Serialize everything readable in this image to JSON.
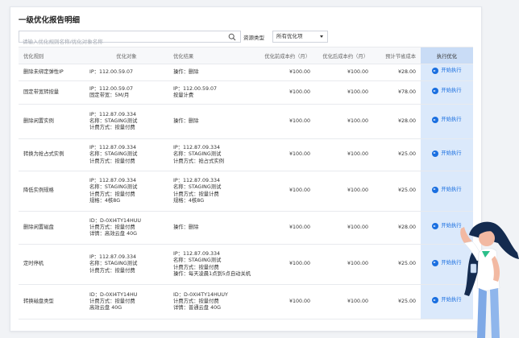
{
  "page_title": "一级优化报告明细",
  "search": {
    "placeholder": "请输入优化规则名称/优化对象名称"
  },
  "filter": {
    "label": "资源类型",
    "selected": "所有优化项"
  },
  "table": {
    "headers": [
      "优化规则",
      "优化对象",
      "优化结果",
      "优化前成本约（月）",
      "优化后成本约（月）",
      "预计节省成本",
      "执行优化"
    ],
    "rows": [
      {
        "rule": "删除未绑定弹性IP",
        "object": [
          "IP：112.00.59.07"
        ],
        "result": [
          "操作：删除"
        ],
        "before": "¥100.00",
        "after": "¥100.00",
        "saving": "¥28.00",
        "action": "开始执行"
      },
      {
        "rule": "固定带宽转按量",
        "object": [
          "IP：112.00.59.07",
          "固定带宽：5M/月"
        ],
        "result": [
          "IP：112.00.59.07",
          "按量计费"
        ],
        "before": "¥100.00",
        "after": "¥100.00",
        "saving": "¥78.00",
        "action": "开始执行"
      },
      {
        "rule": "删除闲置实例",
        "object": [
          "IP：112.87.09.334",
          "名称：STAGING测试",
          "计费方式：按量付费"
        ],
        "result": [
          "操作：删除"
        ],
        "before": "¥100.00",
        "after": "¥100.00",
        "saving": "¥28.00",
        "action": "开始执行"
      },
      {
        "rule": "转换为抢占式实例",
        "object": [
          "IP：112.87.09.334",
          "名称：STAGING测试",
          "计费方式：按量付费"
        ],
        "result": [
          "IP：112.87.09.334",
          "名称：STAGING测试",
          "计费方式：抢占式实例"
        ],
        "before": "¥100.00",
        "after": "¥100.00",
        "saving": "¥25.00",
        "action": "开始执行"
      },
      {
        "rule": "降低实例规格",
        "object": [
          "IP：112.87.09.334",
          "名称：STAGING测试",
          "计费方式：按量付费",
          "规格：4核8G"
        ],
        "result": [
          "IP：112.87.09.334",
          "名称：STAGING测试",
          "计费方式：按量计费",
          "规格：4核8G"
        ],
        "before": "¥100.00",
        "after": "¥100.00",
        "saving": "¥25.00",
        "action": "开始执行"
      },
      {
        "rule": "删除闲置磁盘",
        "object": [
          "ID：D-0XI4TY14HUU",
          "计费方式：按量付费",
          "详情：高效云盘 40G"
        ],
        "result": [
          "操作：删除"
        ],
        "before": "¥100.00",
        "after": "¥100.00",
        "saving": "¥28.00",
        "action": "开始执行"
      },
      {
        "rule": "定时停机",
        "object": [
          "IP：112.87.09.334",
          "名称：STAGING测试",
          "计费方式：按量付费"
        ],
        "result": [
          "IP：112.87.09.334",
          "名称：STAGING测试",
          "计费方式：按量付费",
          "操作：每天凌晨1点到5点自动关机"
        ],
        "before": "¥100.00",
        "after": "¥100.00",
        "saving": "¥25.00",
        "action": "开始执行"
      },
      {
        "rule": "转换磁盘类型",
        "object": [
          "ID：D-0XI4TY14HU",
          "计费方式：按量付费",
          "高效云盘 40G"
        ],
        "result": [
          "ID：D-0XI4TY14HUUY",
          "计费方式：按量付费",
          "详情：普通云盘 40G"
        ],
        "before": "¥100.00",
        "after": "¥100.00",
        "saving": "¥25.00",
        "action": "开始执行"
      }
    ]
  },
  "colors": {
    "accent": "#1a6fe0",
    "action_column": "#dbe9fb",
    "illustration_shirt": "#ffffff",
    "illustration_hair": "#142b4f"
  }
}
